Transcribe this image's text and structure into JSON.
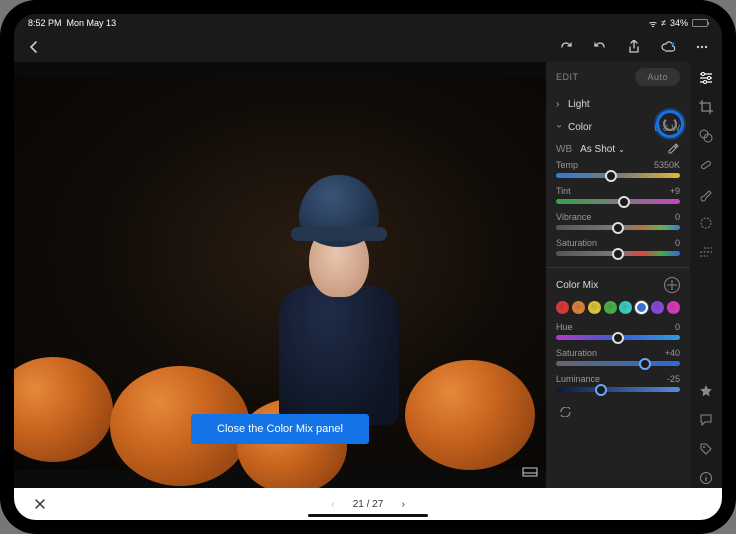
{
  "status": {
    "time": "8:52 PM",
    "date": "Mon May 13",
    "battery": "34%"
  },
  "panel": {
    "edit_label": "EDIT",
    "auto_label": "Auto",
    "light_label": "Light",
    "color_label": "Color",
    "bw_label": "B & W",
    "wb_label": "WB",
    "wb_value": "As Shot",
    "temp": {
      "label": "Temp",
      "value": "5350K",
      "pos": 44
    },
    "tint": {
      "label": "Tint",
      "value": "+9",
      "pos": 55
    },
    "vibrance": {
      "label": "Vibrance",
      "value": "0",
      "pos": 50
    },
    "saturation": {
      "label": "Saturation",
      "value": "0",
      "pos": 50
    },
    "colormix_label": "Color Mix",
    "swatches": [
      "#e23b3b",
      "#e6863b",
      "#e6cf3b",
      "#4ab84a",
      "#3bd6cc",
      "#3b7be6",
      "#8a4be6",
      "#e23bc0"
    ],
    "swatch_selected": 5,
    "hue": {
      "label": "Hue",
      "value": "0",
      "pos": 50
    },
    "sat2": {
      "label": "Saturation",
      "value": "+40",
      "pos": 72
    },
    "lum": {
      "label": "Luminance",
      "value": "-25",
      "pos": 36
    }
  },
  "tooltip": "Close the Color Mix panel",
  "pager": {
    "current": "21",
    "total": "27",
    "sep": " / "
  }
}
